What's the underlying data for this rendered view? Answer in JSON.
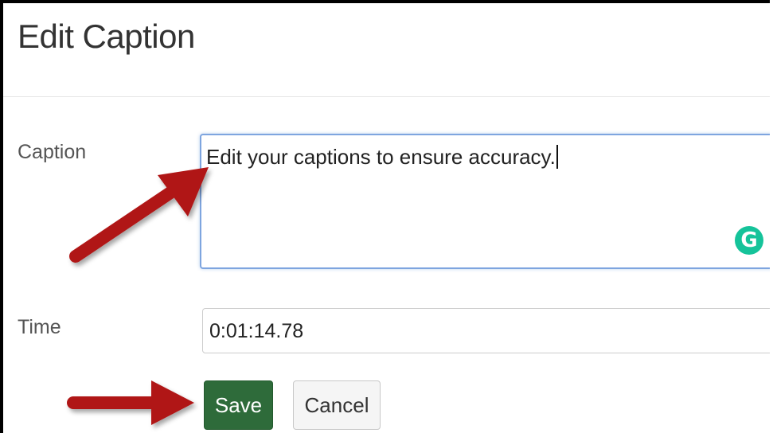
{
  "dialog": {
    "title": "Edit Caption"
  },
  "form": {
    "caption_label": "Caption",
    "caption_value": "Edit your captions to ensure accuracy.",
    "time_label": "Time",
    "time_value": "0:01:14.78"
  },
  "extension": {
    "icon": "grammarly-icon",
    "glyph": "G",
    "color": "#15c39a"
  },
  "buttons": {
    "save_label": "Save",
    "cancel_label": "Cancel"
  },
  "colors": {
    "save_bg": "#2e6b3a",
    "arrow": "#b01515",
    "focus_border": "#7ea5df"
  }
}
